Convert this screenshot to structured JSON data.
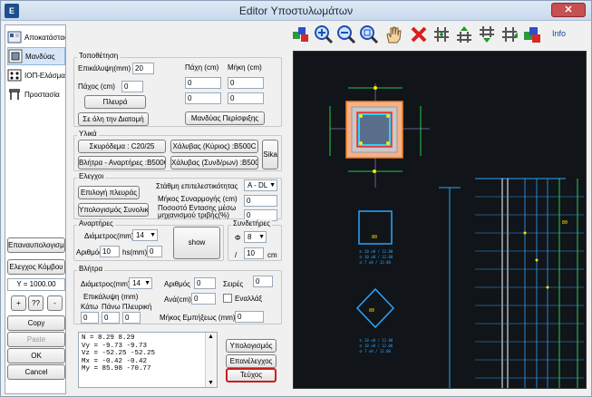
{
  "window": {
    "title": "Editor Υποστυλωμάτων"
  },
  "sidebar": {
    "items": [
      {
        "label": "Αποκατάστασ"
      },
      {
        "label": "Μανδύας"
      },
      {
        "label": "ΙΟΠ-Ελάσματ"
      },
      {
        "label": "Προστασία"
      }
    ],
    "recalc_label": "Επαναυπολογισμός",
    "check_label": "Ελεγχος Κόμβου",
    "y_value": "Y = 1000.00",
    "plus_label": "+",
    "question_label": "??",
    "minus_label": "-",
    "copy_label": "Copy",
    "paste_label": "Paste",
    "ok_label": "OK",
    "cancel_label": "Cancel"
  },
  "placement": {
    "group_label": "Τοποθέτηση",
    "cover_label": "Επικάλυψη(mm)",
    "cover_value": "20",
    "thickness_label": "Πάχος (cm)",
    "thickness_value": "0",
    "side_button": "Πλευρά",
    "whole_span_button": "Σε όλη την Διατομή",
    "width_label": "Πάχη (cm)",
    "length_label": "Μήκη (cm)",
    "width_values": [
      "0",
      "0",
      "0"
    ],
    "length_values": [
      "0",
      "0",
      "0"
    ],
    "perimeter_button": "Μανδύας Περίσφιξης"
  },
  "materials": {
    "group_label": "Υλικά",
    "concrete": "Σκυρόδεμα : C20/25",
    "steel_main": "Χάλυβας (Κύριος) :B500C",
    "dowels": "Βλήτρα - Αναρτήρες :B500C",
    "steel_secondary": "Χάλυβας (Συνδ/ρων) :B500C",
    "sika": "Sika"
  },
  "checks": {
    "group_label": "Ελεγχοι",
    "select_side": "Επιλογή πλευράς",
    "total_calc": "Υπολογισμός Συνολικά",
    "performance_label": "Στάθμη επιτελεστικότητας",
    "performance_value": "A - DL",
    "overlap_label": "Μήκος Συναρμογής (cm)",
    "overlap_value": "0",
    "friction_label": "Ποσοστό Εντασης μέσω μηχανισμού τριβής(%)",
    "friction_value": "0"
  },
  "stirrups_left": {
    "group_label": "Αναρτήρες",
    "diameter_label": "Διάμετρος(mm)",
    "diameter_value": "14",
    "count_label": "Αριθμός",
    "count_value": "10",
    "spacing_label": "hs(mm)",
    "spacing_value": "0",
    "show_button": "show"
  },
  "stirrups_right": {
    "group_label": "Συνδετήρες",
    "phi_label": "Φ",
    "phi_value": "8",
    "slash": "/",
    "spacing_value": "10",
    "unit": "cm"
  },
  "dowels": {
    "group_label": "Βλήτρα",
    "diameter_label": "Διάμετρος(mm)",
    "diameter_value": "14",
    "count_label": "Αριθμός",
    "count_value": "0",
    "rows_label": "Σειρές",
    "rows_value": "0",
    "cover_label": "Επικάλυψη (mm)",
    "bottom_label": "Κάτω",
    "top_label": "Πάνω Πλευρική",
    "cover_values": [
      "0",
      "0",
      "0"
    ],
    "per_label": "Ανά(cm)",
    "per_value": "0",
    "alternate_label": "Εναλλάξ",
    "embed_label": "Μήκος Εμπήξεως (mm)",
    "embed_value": "0"
  },
  "results": {
    "lines": [
      "N  = 8.29 8.29",
      "Vy = -9.73 -9.73",
      "Vz = -52.25 -52.25",
      "Mx = -0.42 -0.42",
      "My = 85.98 -70.77"
    ]
  },
  "actions": {
    "calc_button": "Υπολογισμός",
    "check_button": "Επανέλεγχος",
    "report_button": "Τεύχος"
  },
  "toolbar": {
    "icons": [
      "color-palette-icon",
      "zoom-in-icon",
      "zoom-out-icon",
      "zoom-window-icon",
      "pan-hand-icon",
      "delete-icon",
      "rebar-add-icon",
      "rebar-up-icon",
      "rebar-down-icon",
      "rebar-flip-icon",
      "3d-view-icon"
    ],
    "info_label": "Info"
  },
  "drawing": {
    "labels": [
      "80",
      "80",
      "80"
    ]
  }
}
